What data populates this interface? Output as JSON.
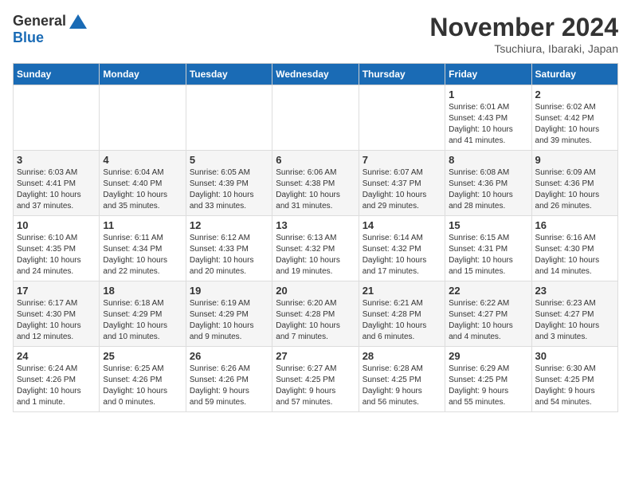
{
  "logo": {
    "general": "General",
    "blue": "Blue"
  },
  "title": "November 2024",
  "location": "Tsuchiura, Ibaraki, Japan",
  "weekdays": [
    "Sunday",
    "Monday",
    "Tuesday",
    "Wednesday",
    "Thursday",
    "Friday",
    "Saturday"
  ],
  "weeks": [
    [
      {
        "day": "",
        "info": ""
      },
      {
        "day": "",
        "info": ""
      },
      {
        "day": "",
        "info": ""
      },
      {
        "day": "",
        "info": ""
      },
      {
        "day": "",
        "info": ""
      },
      {
        "day": "1",
        "info": "Sunrise: 6:01 AM\nSunset: 4:43 PM\nDaylight: 10 hours\nand 41 minutes."
      },
      {
        "day": "2",
        "info": "Sunrise: 6:02 AM\nSunset: 4:42 PM\nDaylight: 10 hours\nand 39 minutes."
      }
    ],
    [
      {
        "day": "3",
        "info": "Sunrise: 6:03 AM\nSunset: 4:41 PM\nDaylight: 10 hours\nand 37 minutes."
      },
      {
        "day": "4",
        "info": "Sunrise: 6:04 AM\nSunset: 4:40 PM\nDaylight: 10 hours\nand 35 minutes."
      },
      {
        "day": "5",
        "info": "Sunrise: 6:05 AM\nSunset: 4:39 PM\nDaylight: 10 hours\nand 33 minutes."
      },
      {
        "day": "6",
        "info": "Sunrise: 6:06 AM\nSunset: 4:38 PM\nDaylight: 10 hours\nand 31 minutes."
      },
      {
        "day": "7",
        "info": "Sunrise: 6:07 AM\nSunset: 4:37 PM\nDaylight: 10 hours\nand 29 minutes."
      },
      {
        "day": "8",
        "info": "Sunrise: 6:08 AM\nSunset: 4:36 PM\nDaylight: 10 hours\nand 28 minutes."
      },
      {
        "day": "9",
        "info": "Sunrise: 6:09 AM\nSunset: 4:36 PM\nDaylight: 10 hours\nand 26 minutes."
      }
    ],
    [
      {
        "day": "10",
        "info": "Sunrise: 6:10 AM\nSunset: 4:35 PM\nDaylight: 10 hours\nand 24 minutes."
      },
      {
        "day": "11",
        "info": "Sunrise: 6:11 AM\nSunset: 4:34 PM\nDaylight: 10 hours\nand 22 minutes."
      },
      {
        "day": "12",
        "info": "Sunrise: 6:12 AM\nSunset: 4:33 PM\nDaylight: 10 hours\nand 20 minutes."
      },
      {
        "day": "13",
        "info": "Sunrise: 6:13 AM\nSunset: 4:32 PM\nDaylight: 10 hours\nand 19 minutes."
      },
      {
        "day": "14",
        "info": "Sunrise: 6:14 AM\nSunset: 4:32 PM\nDaylight: 10 hours\nand 17 minutes."
      },
      {
        "day": "15",
        "info": "Sunrise: 6:15 AM\nSunset: 4:31 PM\nDaylight: 10 hours\nand 15 minutes."
      },
      {
        "day": "16",
        "info": "Sunrise: 6:16 AM\nSunset: 4:30 PM\nDaylight: 10 hours\nand 14 minutes."
      }
    ],
    [
      {
        "day": "17",
        "info": "Sunrise: 6:17 AM\nSunset: 4:30 PM\nDaylight: 10 hours\nand 12 minutes."
      },
      {
        "day": "18",
        "info": "Sunrise: 6:18 AM\nSunset: 4:29 PM\nDaylight: 10 hours\nand 10 minutes."
      },
      {
        "day": "19",
        "info": "Sunrise: 6:19 AM\nSunset: 4:29 PM\nDaylight: 10 hours\nand 9 minutes."
      },
      {
        "day": "20",
        "info": "Sunrise: 6:20 AM\nSunset: 4:28 PM\nDaylight: 10 hours\nand 7 minutes."
      },
      {
        "day": "21",
        "info": "Sunrise: 6:21 AM\nSunset: 4:28 PM\nDaylight: 10 hours\nand 6 minutes."
      },
      {
        "day": "22",
        "info": "Sunrise: 6:22 AM\nSunset: 4:27 PM\nDaylight: 10 hours\nand 4 minutes."
      },
      {
        "day": "23",
        "info": "Sunrise: 6:23 AM\nSunset: 4:27 PM\nDaylight: 10 hours\nand 3 minutes."
      }
    ],
    [
      {
        "day": "24",
        "info": "Sunrise: 6:24 AM\nSunset: 4:26 PM\nDaylight: 10 hours\nand 1 minute."
      },
      {
        "day": "25",
        "info": "Sunrise: 6:25 AM\nSunset: 4:26 PM\nDaylight: 10 hours\nand 0 minutes."
      },
      {
        "day": "26",
        "info": "Sunrise: 6:26 AM\nSunset: 4:26 PM\nDaylight: 9 hours\nand 59 minutes."
      },
      {
        "day": "27",
        "info": "Sunrise: 6:27 AM\nSunset: 4:25 PM\nDaylight: 9 hours\nand 57 minutes."
      },
      {
        "day": "28",
        "info": "Sunrise: 6:28 AM\nSunset: 4:25 PM\nDaylight: 9 hours\nand 56 minutes."
      },
      {
        "day": "29",
        "info": "Sunrise: 6:29 AM\nSunset: 4:25 PM\nDaylight: 9 hours\nand 55 minutes."
      },
      {
        "day": "30",
        "info": "Sunrise: 6:30 AM\nSunset: 4:25 PM\nDaylight: 9 hours\nand 54 minutes."
      }
    ]
  ]
}
